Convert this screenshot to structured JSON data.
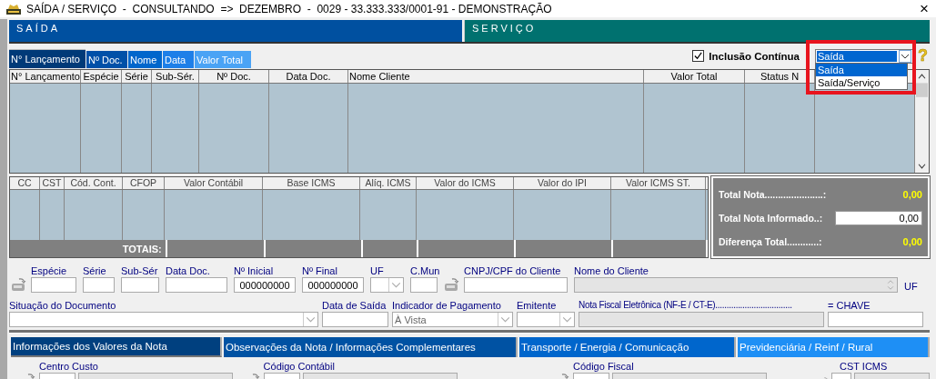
{
  "window": {
    "title": "SAÍDA / SERVIÇO  -  CONSULTANDO  =>  DEZEMBRO  -  0029 - 33.333.333/0001-91 - DEMONSTRAÇÃO",
    "close": "×"
  },
  "header_panels": [
    {
      "label": "SAÍDA",
      "color": "#0050a0"
    },
    {
      "label": "SERVIÇO",
      "color": "#00716f"
    }
  ],
  "sort_tabs": [
    {
      "label": "N° Lançamento",
      "selected": true
    },
    {
      "label": "Nº Doc.",
      "selected": false
    },
    {
      "label": "Nome",
      "selected": false
    },
    {
      "label": "Data",
      "selected": false
    },
    {
      "label": "Valor Total",
      "selected": false
    }
  ],
  "continuous_entry": {
    "label": "Inclusão Contínua",
    "checked": true
  },
  "type_select": {
    "value": "Saída",
    "expanded": true,
    "highlighted": true,
    "options": [
      {
        "label": "Saída",
        "selected": true
      },
      {
        "label": "Saída/Serviço",
        "selected": false
      }
    ]
  },
  "help": "?",
  "main_grid": {
    "columns": [
      "N° Lançamento",
      "Espécie",
      "Série",
      "Sub-Sér.",
      "Nº Doc.",
      "Data Doc.",
      "Nome Cliente",
      "Valor Total",
      "Status N"
    ]
  },
  "items_grid": {
    "columns": [
      "CC",
      "CST",
      "Cód. Cont.",
      "CFOP",
      "Valor Contábil",
      "Base ICMS",
      "Alíq. ICMS",
      "Valor do ICMS",
      "Valor do IPI",
      "Valor ICMS ST."
    ],
    "totals_label": "TOTAIS:"
  },
  "totals": [
    {
      "label": "Total Nota......................:",
      "value": "0,00",
      "kind": "readout"
    },
    {
      "label": "Total Nota Informado..:",
      "value": "0,00",
      "kind": "input"
    },
    {
      "label": "Diferença Total............:",
      "value": "0,00",
      "kind": "readout"
    }
  ],
  "filters": [
    {
      "label": "Espécie",
      "kind": "text",
      "lookup": true
    },
    {
      "label": "Série",
      "kind": "text"
    },
    {
      "label": "Sub-Sér",
      "kind": "text"
    },
    {
      "label": "Data Doc.",
      "kind": "text"
    },
    {
      "label": "Nº Inicial",
      "kind": "text",
      "value": "000000000"
    },
    {
      "label": "Nº Final",
      "kind": "text",
      "value": "000000000"
    },
    {
      "label": "UF",
      "kind": "combo"
    },
    {
      "label": "C.Mun",
      "kind": "text"
    },
    {
      "label": "CNPJ/CPF do Cliente",
      "kind": "text",
      "lookup": true
    },
    {
      "label": "Nome do Cliente",
      "kind": "memo",
      "disabled": true
    },
    {
      "label": "UF",
      "kind": "label"
    }
  ],
  "document_fields": [
    {
      "label": "Situação do Documento",
      "kind": "combo"
    },
    {
      "label": "Data de Saída",
      "kind": "text"
    },
    {
      "label": "Indicador de Pagamento",
      "kind": "combo",
      "value": "À Vista"
    },
    {
      "label": "Emitente",
      "kind": "combo"
    },
    {
      "label": "Nota Fiscal Eletrônica (NF-E / CT-E)..................................",
      "kind": "text",
      "disabled": true
    },
    {
      "label": "=  CHAVE",
      "kind": "text"
    }
  ],
  "detail_tabs": [
    {
      "label": "Informações dos Valores da Nota",
      "selected": true
    },
    {
      "label": "Observações da Nota / Informações Complementares",
      "selected": false
    },
    {
      "label": "Transporte / Energia / Comunicação",
      "selected": false
    },
    {
      "label": "Previdenciária / Reinf / Rural",
      "selected": false
    }
  ],
  "detail_fields": [
    {
      "label": "Centro Custo"
    },
    {
      "label": "Código Contábil"
    },
    {
      "label": "Código Fiscal"
    },
    {
      "label": "CST ICMS"
    }
  ]
}
